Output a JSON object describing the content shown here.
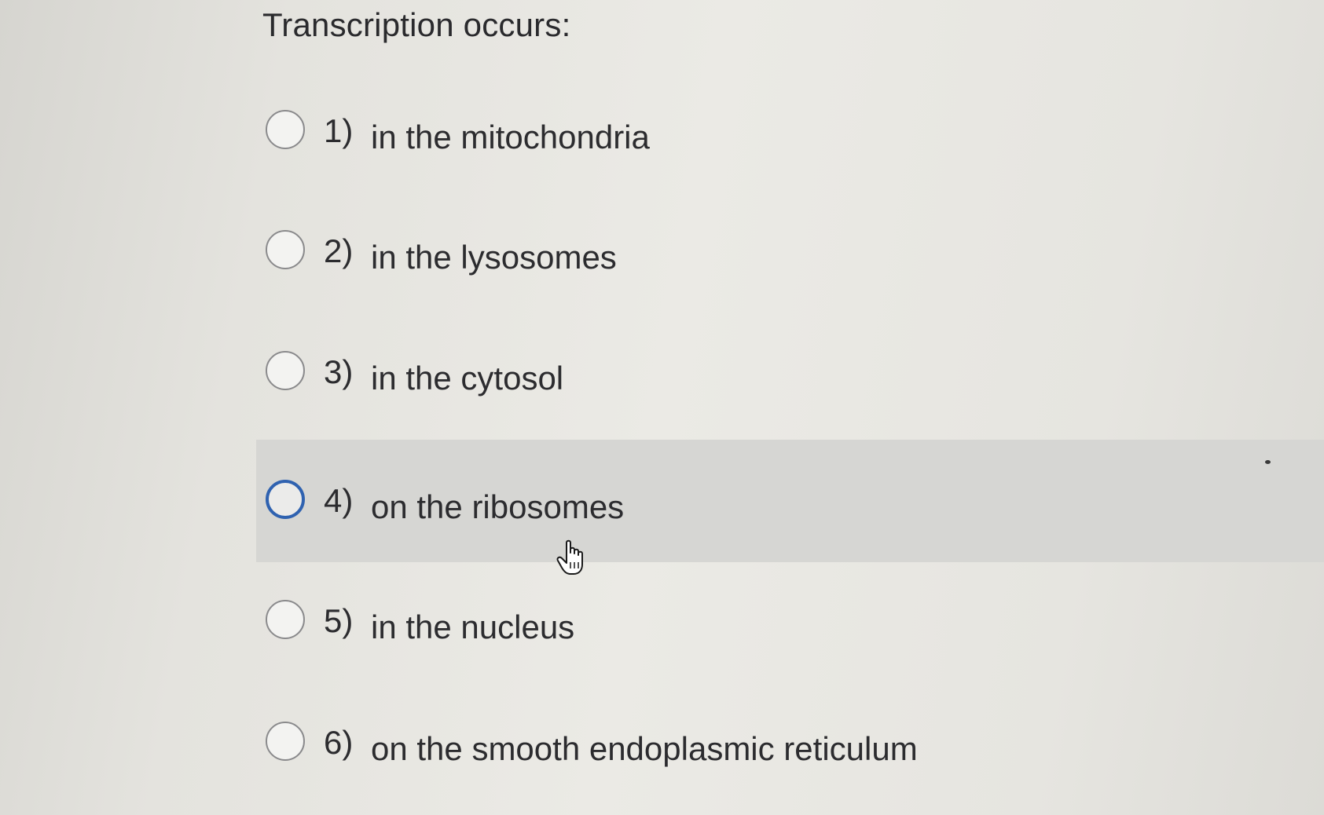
{
  "question": {
    "text": "Transcription occurs:"
  },
  "options": [
    {
      "number": "1)",
      "text": "in the mitochondria",
      "selected": false,
      "hovered": false
    },
    {
      "number": "2)",
      "text": "in the lysosomes",
      "selected": false,
      "hovered": false
    },
    {
      "number": "3)",
      "text": "in the cytosol",
      "selected": false,
      "hovered": false
    },
    {
      "number": "4)",
      "text": "on the ribosomes",
      "selected": false,
      "hovered": true
    },
    {
      "number": "5)",
      "text": "in the nucleus",
      "selected": false,
      "hovered": false
    },
    {
      "number": "6)",
      "text": "on the smooth endoplasmic reticulum",
      "selected": false,
      "hovered": false
    }
  ],
  "colors": {
    "background": "#e8e7e2",
    "hover_row": "#d6d6d3",
    "radio_focus_ring": "#2f62b0",
    "radio_border": "#8a8a8c",
    "text": "#2c2c2f"
  },
  "icons": {
    "cursor": "hand-pointer-icon"
  }
}
